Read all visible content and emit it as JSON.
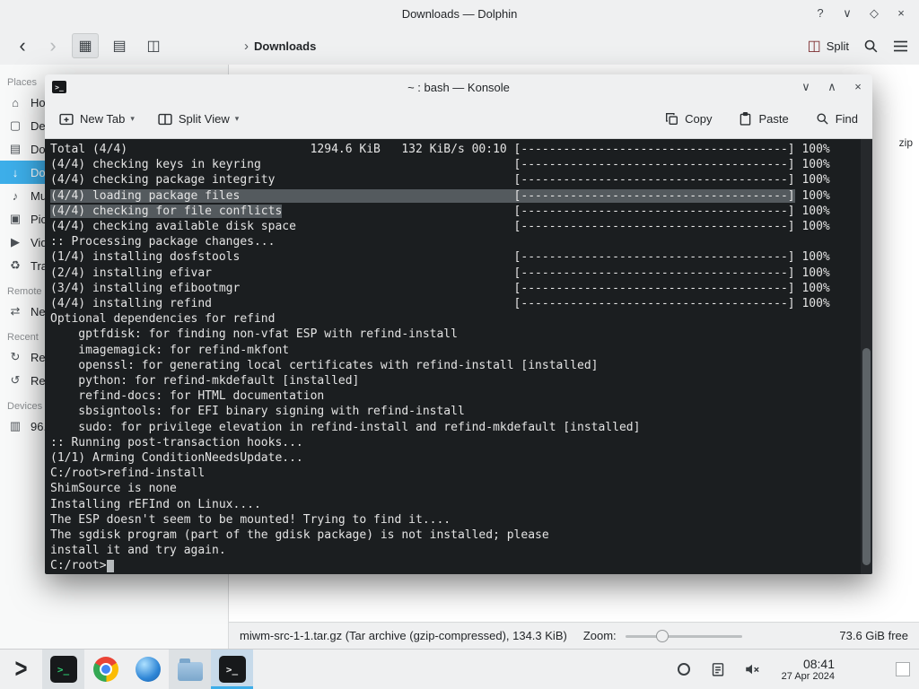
{
  "icons": {
    "help": "?",
    "minimize": "∨",
    "maximize": "∧",
    "restore": "◇",
    "close": "×",
    "back": "‹",
    "forward": "›",
    "breadcrumb_chevron": "›",
    "dropdown": "▾",
    "view_icons": "▦",
    "view_details": "▤",
    "view_split": "◫",
    "split_glyph": "◫",
    "launcher": ">",
    "terminal_glyph": ">_"
  },
  "dolphin": {
    "title": "Downloads — Dolphin",
    "toolbar": {
      "breadcrumb": "Downloads",
      "split_label": "Split"
    },
    "places": {
      "entries": [
        {
          "type": "header",
          "label": "Places"
        },
        {
          "type": "item",
          "label": "Ho",
          "icon": "home-icon"
        },
        {
          "type": "item",
          "label": "De",
          "icon": "desktop-icon"
        },
        {
          "type": "item",
          "label": "Do",
          "icon": "documents-icon"
        },
        {
          "type": "item",
          "label": "Do",
          "icon": "downloads-icon",
          "selected": true
        },
        {
          "type": "item",
          "label": "Mu",
          "icon": "music-icon"
        },
        {
          "type": "item",
          "label": "Pic",
          "icon": "pictures-icon"
        },
        {
          "type": "item",
          "label": "Vid",
          "icon": "videos-icon"
        },
        {
          "type": "item",
          "label": "Tra",
          "icon": "trash-icon"
        },
        {
          "type": "header",
          "label": "Remote"
        },
        {
          "type": "item",
          "label": "Ne",
          "icon": "network-icon"
        },
        {
          "type": "header",
          "label": "Recent"
        },
        {
          "type": "item",
          "label": "Re",
          "icon": "recent-files-icon"
        },
        {
          "type": "item",
          "label": "Re",
          "icon": "recent-locations-icon"
        },
        {
          "type": "header",
          "label": "Devices"
        },
        {
          "type": "item",
          "label": "96.",
          "icon": "harddrive-icon"
        }
      ]
    },
    "view_fragment": "zip",
    "statusbar": {
      "file_info": "miwm-src-1-1.tar.gz (Tar archive (gzip-compressed), 134.3 KiB)",
      "zoom_label": "Zoom:",
      "free_space": "73.6 GiB free"
    }
  },
  "konsole": {
    "title": "~ : bash — Konsole",
    "toolbar": {
      "new_tab": "New Tab",
      "split_view": "Split View",
      "copy": "Copy",
      "paste": "Paste",
      "find": "Find"
    },
    "terminal": {
      "bar_segments": 38,
      "lines": [
        {
          "left": "Total (4/4)",
          "mid": "1294.6 KiB   132 KiB/s 00:10",
          "bar": true,
          "pct": "100%"
        },
        {
          "left": "(4/4) checking keys in keyring",
          "bar": true,
          "pct": "100%"
        },
        {
          "left": "(4/4) checking package integrity",
          "bar": true,
          "pct": "100%"
        },
        {
          "left": "(4/4) loading package files",
          "bar": true,
          "pct": "100%",
          "sel": 106
        },
        {
          "left": "(4/4) checking for file conflicts",
          "bar": true,
          "pct": "100%",
          "sel": 33
        },
        {
          "left": "(4/4) checking available disk space",
          "bar": true,
          "pct": "100%"
        },
        {
          "left": ":: Processing package changes..."
        },
        {
          "left": "(1/4) installing dosfstools",
          "bar": true,
          "pct": "100%"
        },
        {
          "left": "(2/4) installing efivar",
          "bar": true,
          "pct": "100%"
        },
        {
          "left": "(3/4) installing efibootmgr",
          "bar": true,
          "pct": "100%"
        },
        {
          "left": "(4/4) installing refind",
          "bar": true,
          "pct": "100%"
        },
        {
          "left": "Optional dependencies for refind"
        },
        {
          "left": "    gptfdisk: for finding non-vfat ESP with refind-install"
        },
        {
          "left": "    imagemagick: for refind-mkfont"
        },
        {
          "left": "    openssl: for generating local certificates with refind-install [installed]"
        },
        {
          "left": "    python: for refind-mkdefault [installed]"
        },
        {
          "left": "    refind-docs: for HTML documentation"
        },
        {
          "left": "    sbsigntools: for EFI binary signing with refind-install"
        },
        {
          "left": "    sudo: for privilege elevation in refind-install and refind-mkdefault [installed]"
        },
        {
          "left": ":: Running post-transaction hooks..."
        },
        {
          "left": "(1/1) Arming ConditionNeedsUpdate..."
        },
        {
          "left": "C:/root>refind-install"
        },
        {
          "left": "ShimSource is none"
        },
        {
          "left": "Installing rEFInd on Linux...."
        },
        {
          "left": "The ESP doesn't seem to be mounted! Trying to find it...."
        },
        {
          "left": "The sgdisk program (part of the gdisk package) is not installed; please"
        },
        {
          "left": "install it and try again."
        }
      ],
      "prompt": "C:/root>"
    }
  },
  "taskbar": {
    "clock_time": "08:41",
    "clock_date": "27 Apr 2024"
  }
}
